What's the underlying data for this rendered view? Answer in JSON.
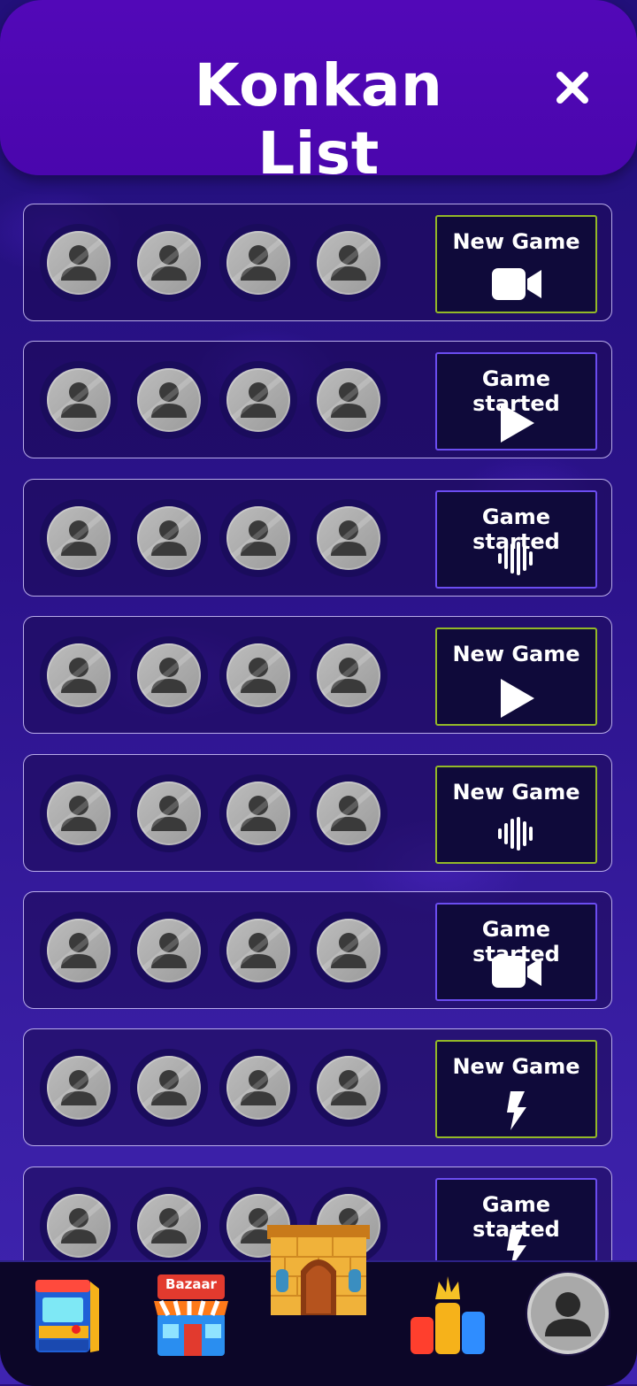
{
  "header": {
    "title": "Konkan List",
    "close_icon": "close-icon"
  },
  "rooms": [
    {
      "status": "New Game",
      "kind": "new",
      "icon": "video-camera-icon"
    },
    {
      "status": "Game started",
      "kind": "started",
      "icon": "play-icon"
    },
    {
      "status": "Game started",
      "kind": "started",
      "icon": "voice-wave-icon"
    },
    {
      "status": "New Game",
      "kind": "new",
      "icon": "play-icon"
    },
    {
      "status": "New Game",
      "kind": "new",
      "icon": "voice-wave-icon"
    },
    {
      "status": "Game started",
      "kind": "started",
      "icon": "video-camera-icon"
    },
    {
      "status": "New Game",
      "kind": "new",
      "icon": "lightning-icon"
    },
    {
      "status": "Game started",
      "kind": "started",
      "icon": "lightning-icon"
    }
  ],
  "bottom_nav": {
    "items": [
      {
        "icon": "arcade-machine-icon"
      },
      {
        "icon": "bazaar-shop-icon",
        "sign": "Bazaar"
      },
      {
        "icon": "home-building-icon"
      },
      {
        "icon": "leaderboard-crown-icon"
      },
      {
        "icon": "profile-avatar-icon"
      }
    ]
  },
  "colors": {
    "header": "#5208b8",
    "new_border": "#93b828",
    "started_border": "#6b4df0",
    "background": "#2a1080"
  }
}
